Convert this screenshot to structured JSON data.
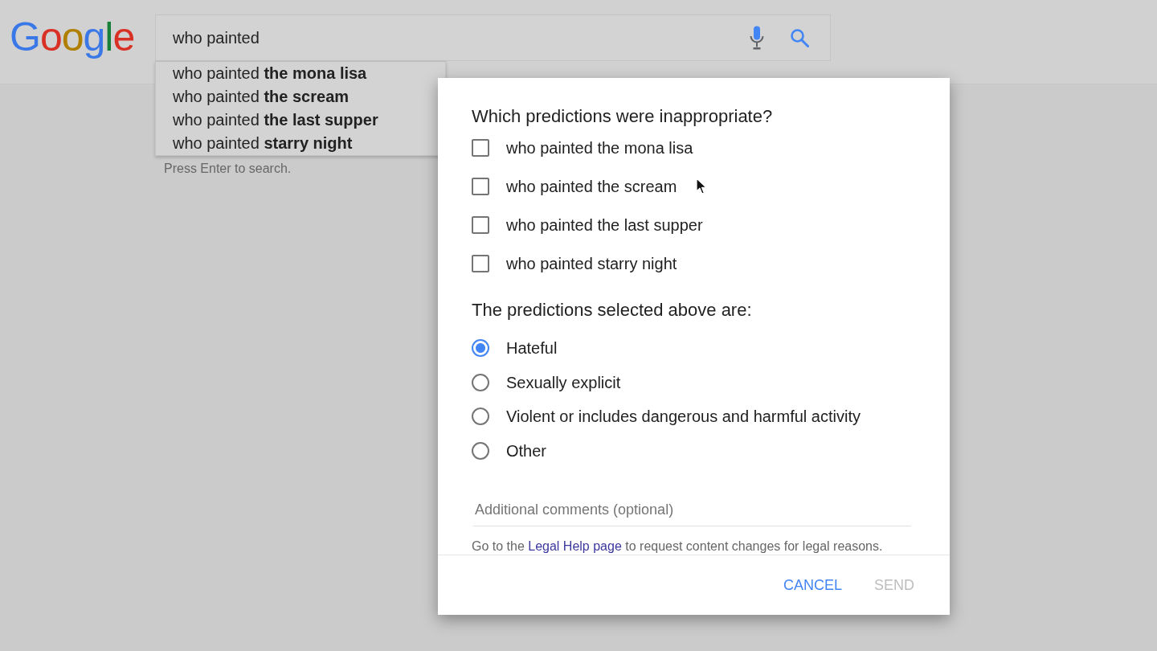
{
  "logo": {
    "text": "Google"
  },
  "search": {
    "value": "who painted"
  },
  "suggestions": [
    "who painted **the mona lisa**",
    "who painted **the scream**",
    "who painted **the last supper**",
    "who painted **starry night**"
  ],
  "hint": "Press Enter to search.",
  "dialog": {
    "question": "Which predictions were inappropriate?",
    "predictions": [
      {
        "label": "who painted the mona lisa",
        "checked": false
      },
      {
        "label": "who painted the scream",
        "checked": false
      },
      {
        "label": "who painted the last supper",
        "checked": false
      },
      {
        "label": "who painted starry night",
        "checked": false
      }
    ],
    "category_question": "The predictions selected above are:",
    "categories": [
      {
        "label": "Hateful",
        "selected": true
      },
      {
        "label": "Sexually explicit",
        "selected": false
      },
      {
        "label": "Violent or includes dangerous and harmful activity",
        "selected": false
      },
      {
        "label": "Other",
        "selected": false
      }
    ],
    "comments": {
      "placeholder": "Additional comments (optional)"
    },
    "legal_note": {
      "before": "Go to the",
      "link": "Legal Help page",
      "after": "to request content changes for legal reasons."
    },
    "buttons": [
      {
        "label": "CANCEL",
        "disabled": false
      },
      {
        "label": "SEND",
        "disabled": true
      }
    ]
  }
}
